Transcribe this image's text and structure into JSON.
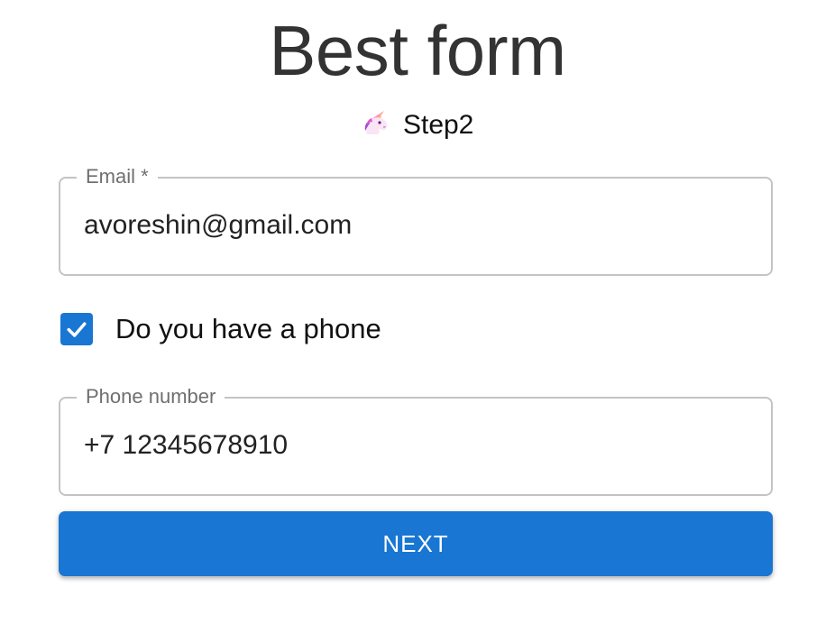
{
  "header": {
    "title": "Best form",
    "step_label": "Step2",
    "step_icon": "unicorn-icon"
  },
  "form": {
    "email": {
      "label": "Email *",
      "value": "avoreshin@gmail.com"
    },
    "has_phone": {
      "label": "Do you have a phone",
      "checked": true
    },
    "phone": {
      "label": "Phone number",
      "value": "+7 12345678910"
    },
    "next_button_label": "NEXT"
  },
  "colors": {
    "accent": "#1976d2",
    "border": "#c4c4c4",
    "label": "#6f6f6f"
  }
}
